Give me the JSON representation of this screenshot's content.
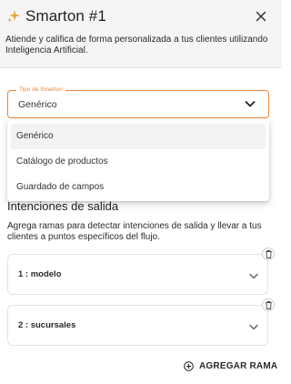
{
  "header": {
    "title": "Smarton #1",
    "subtitle": "Atiende y califica de forma personalizada a tus clientes utilizando Inteligencia Artificial.",
    "icon": "sparkle-icon",
    "accent": "#e8a33b"
  },
  "smarton_type": {
    "label": "Tipo de Smarton",
    "value": "Genérico",
    "accent": "#e8863b",
    "options": [
      "Genérico",
      "Catálogo de productos",
      "Guardado de campos"
    ]
  },
  "intents": {
    "title": "Intenciones de salida",
    "description": "Agrega ramas para detectar intenciones de salida y llevar a tus clientes a puntos específicos del flujo.",
    "items": [
      {
        "label": "1 : modelo"
      },
      {
        "label": "2 : sucursales"
      }
    ],
    "add_label": "AGREGAR RAMA"
  }
}
